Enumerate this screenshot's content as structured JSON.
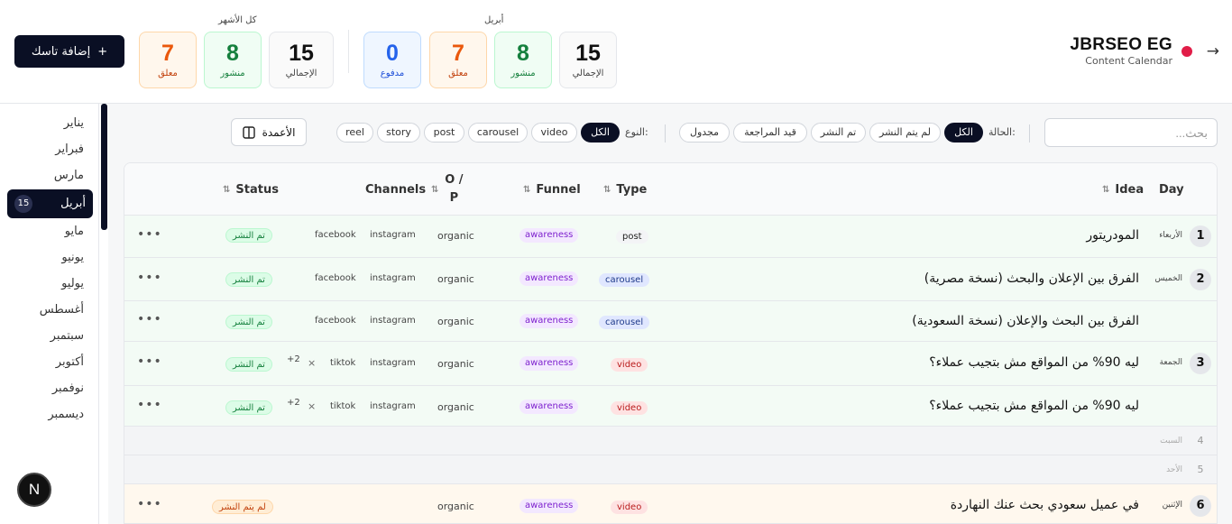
{
  "header": {
    "brand_name": "JBRSEO EG",
    "brand_sub": "Content Calendar",
    "month_group_label": "أبريل",
    "all_group_label": "كل الأشهر",
    "month_stats": {
      "total": {
        "value": "15",
        "label": "الإجمالي"
      },
      "published": {
        "value": "8",
        "label": "منشور"
      },
      "pending": {
        "value": "7",
        "label": "معلق"
      },
      "paid": {
        "value": "0",
        "label": "مدفوع"
      }
    },
    "all_stats": {
      "total": {
        "value": "15",
        "label": "الإجمالي"
      },
      "published": {
        "value": "8",
        "label": "منشور"
      },
      "pending": {
        "value": "7",
        "label": "معلق"
      }
    },
    "add_button": "إضافة تاسك",
    "add_icon": "+"
  },
  "sidebar": {
    "months": [
      "يناير",
      "فبراير",
      "مارس",
      "أبريل",
      "مايو",
      "يونيو",
      "يوليو",
      "أغسطس",
      "سبتمبر",
      "أكتوبر",
      "نوفمبر",
      "ديسمبر"
    ],
    "active_month": "أبريل",
    "active_count": "15",
    "logo_letter": "N"
  },
  "toolbar": {
    "search_placeholder": "بحث...",
    "status_label": "الحالة:",
    "status_chips": [
      "الكل",
      "لم يتم النشر",
      "تم النشر",
      "قيد المراجعة",
      "مجدول"
    ],
    "type_label": "النوع:",
    "type_chips": [
      "الكل",
      "video",
      "carousel",
      "post",
      "story",
      "reel"
    ],
    "columns_button": "الأعمدة"
  },
  "table": {
    "headers": {
      "day": "Day",
      "idea": "Idea",
      "type": "Type",
      "funnel": "Funnel",
      "op": "O / P",
      "channels": "Channels",
      "status": "Status"
    },
    "rows": [
      {
        "day_num": "1",
        "day_name": "الأربعاء",
        "idea": "المودريتور",
        "type": "post",
        "funnel": "awareness",
        "op": "organic",
        "channels": [
          "instagram",
          "facebook"
        ],
        "status": "تم النشر"
      },
      {
        "day_num": "2",
        "day_name": "الخميس",
        "idea": "الفرق بين الإعلان والبحث (نسخة مصرية)",
        "type": "carousel",
        "funnel": "awareness",
        "op": "organic",
        "channels": [
          "instagram",
          "facebook"
        ],
        "status": "تم النشر"
      },
      {
        "day_num": "",
        "day_name": "",
        "idea": "الفرق بين البحث والإعلان (نسخة السعودية)",
        "type": "carousel",
        "funnel": "awareness",
        "op": "organic",
        "channels": [
          "instagram",
          "facebook"
        ],
        "status": "تم النشر"
      },
      {
        "day_num": "3",
        "day_name": "الجمعة",
        "idea": "ليه 90% من المواقع مش بتجيب عملاء؟",
        "type": "video",
        "funnel": "awareness",
        "op": "organic",
        "channels": [
          "instagram",
          "tiktok",
          "×",
          "+2"
        ],
        "status": "تم النشر"
      },
      {
        "day_num": "",
        "day_name": "",
        "idea": "ليه 90% من المواقع مش بتجيب عملاء؟",
        "type": "video",
        "funnel": "awareness",
        "op": "organic",
        "channels": [
          "instagram",
          "tiktok",
          "×",
          "+2"
        ],
        "status": "تم النشر"
      },
      {
        "day_num": "4",
        "day_name": "السبت"
      },
      {
        "day_num": "5",
        "day_name": "الأحد"
      },
      {
        "day_num": "6",
        "day_name": "الإثنين",
        "idea": "في عميل سعودي بحث عنك النهاردة",
        "type": "video",
        "funnel": "awareness",
        "op": "organic",
        "channels": [],
        "status": "لم يتم النشر"
      }
    ],
    "more_icon": "•••"
  },
  "colors": {
    "accent": "#0a0f24",
    "published": "#15803d",
    "pending": "#ea580c",
    "paid": "#2563eb",
    "funnel": "#7e22ce"
  }
}
